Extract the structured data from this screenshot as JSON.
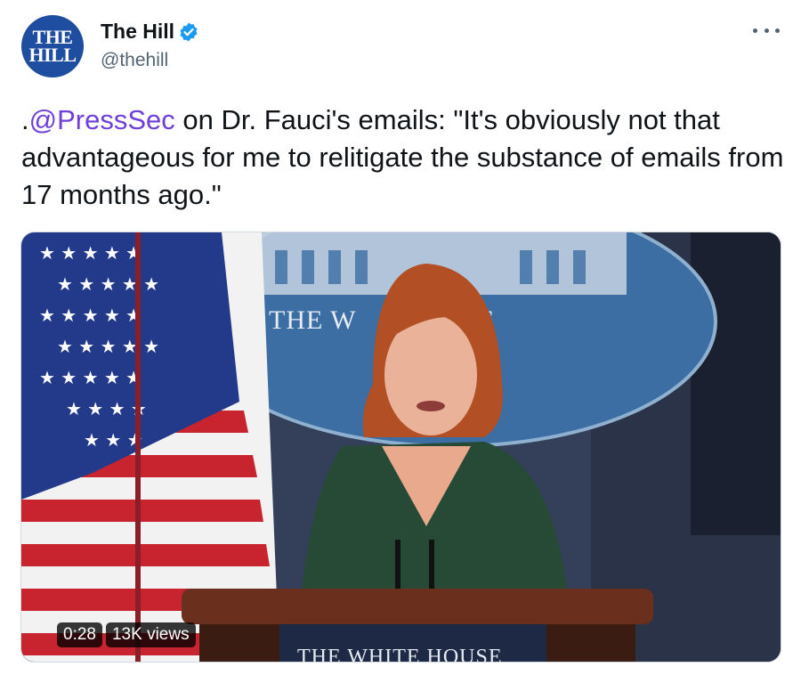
{
  "account": {
    "avatar_text_line1": "THE",
    "avatar_text_line2": "HILL",
    "display_name": "The Hill",
    "handle": "@thehill",
    "verified_color": "#1d9bf0"
  },
  "tweet": {
    "prefix": ".",
    "mention": "@PressSec",
    "body": " on Dr. Fauci's emails: \"It's obviously not that advantageous for me to relitigate the substance of emails from 17 months ago.\"",
    "mention_color": "#6f3fd8"
  },
  "video": {
    "duration": "0:28",
    "views": "13K views",
    "seal_text": "THE W      HOUSE",
    "podium_text": "THE WHITE HOUSE"
  },
  "icons": {
    "verified": "verified-badge-icon",
    "more": "more-options-icon"
  }
}
